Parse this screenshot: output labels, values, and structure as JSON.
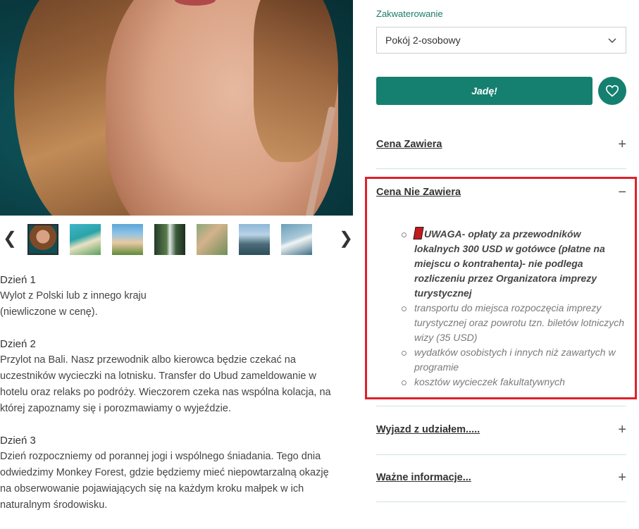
{
  "gallery": {
    "prev_arrow": "❮",
    "next_arrow": "❯",
    "thumbnails": [
      "portrait",
      "beach-cliff",
      "palm-terrace",
      "waterfall",
      "swing",
      "ocean-rocks",
      "surfer"
    ]
  },
  "itinerary": [
    {
      "title": "Dzień 1",
      "lines": [
        "Wylot z Polski lub z innego kraju",
        "(niewliczone w cenę)."
      ]
    },
    {
      "title": "Dzień 2",
      "lines": [
        "Przylot na Bali. Nasz przewodnik albo kierowca będzie czekać na",
        "uczestników wycieczki na lotnisku. Transfer do Ubud zameldowanie w",
        "hotelu oraz relaks po podróży. Wieczorem czeka nas wspólna kolacja, na",
        "której zapoznamy się i porozmawiamy o wyjeździe."
      ]
    },
    {
      "title": "Dzień 3",
      "lines": [
        "Dzień rozpoczniemy od porannej jogi i wspólnego śniadania. Tego dnia",
        "odwiedzimy Monkey Forest, gdzie będziemy mieć niepowtarzalną okazję",
        "na obserwowanie pojawiających się na każdym kroku małpek w ich",
        "naturalnym środowisku."
      ]
    }
  ],
  "booking": {
    "accommodation_label": "Zakwaterowanie",
    "accommodation_value": "Pokój 2-osobowy",
    "go_button": "Jadę!",
    "accent_color": "#15806f"
  },
  "accordion": {
    "price_includes": {
      "title": "Cena Zawiera",
      "sign": "+"
    },
    "price_excludes": {
      "title": "Cena Nie Zawiera",
      "sign": "−",
      "items": [
        "UWAGA- opłaty za przewodników lokalnych 300 USD w gotówce (płatne na miejscu o kontrahenta)- nie podlega rozliczeniu przez Organizatora imprezy turystycznej",
        "transportu do miejsca rozpoczęcia imprezy turystycznej oraz powrotu tzn. biletów lotniczych wizy (35 USD)",
        "wydatków osobistych i innych niż zawartych w programie",
        "kosztów wycieczek fakultatywnych"
      ]
    },
    "departure": {
      "title": "Wyjazd z udziałem.....",
      "sign": "+"
    },
    "important": {
      "title": "Ważne informacje...",
      "sign": "+"
    }
  },
  "highlight_color": "#e0202a"
}
